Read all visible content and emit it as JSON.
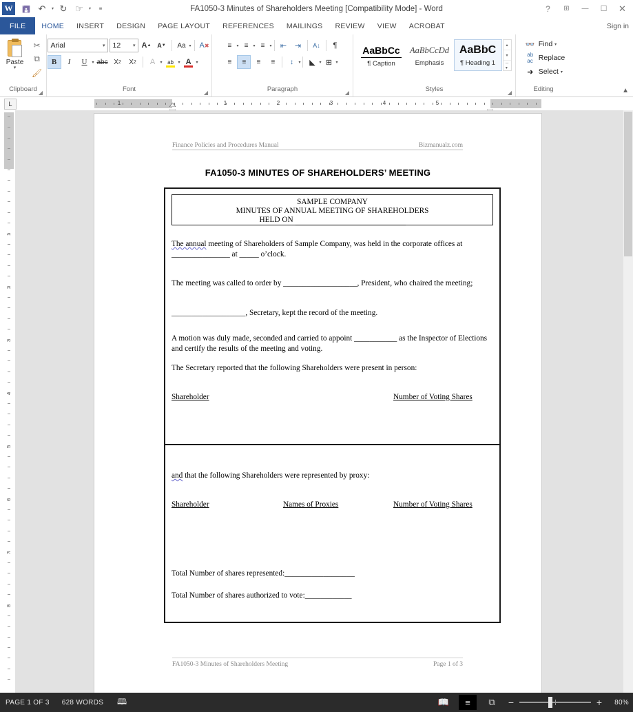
{
  "titlebar": {
    "app_icon": "word-logo-icon",
    "quick_access": [
      {
        "name": "save-button",
        "glyph": "▣"
      },
      {
        "name": "undo-button",
        "glyph": "↶"
      },
      {
        "name": "redo-button",
        "glyph": "↻"
      },
      {
        "name": "touch-mode-button",
        "glyph": "☝"
      },
      {
        "name": "customize-quick-access-button",
        "glyph": "☰"
      }
    ],
    "title": "FA1050-3 Minutes of Shareholders Meeting [Compatibility Mode] - Word",
    "help": "?",
    "ribbon_display_options": "⬆",
    "minimize": "—",
    "restore": "❐",
    "close": "✕"
  },
  "tabs": [
    {
      "label": "FILE",
      "active": false,
      "file": true
    },
    {
      "label": "HOME",
      "active": true
    },
    {
      "label": "INSERT",
      "active": false
    },
    {
      "label": "DESIGN",
      "active": false
    },
    {
      "label": "PAGE LAYOUT",
      "active": false
    },
    {
      "label": "REFERENCES",
      "active": false
    },
    {
      "label": "MAILINGS",
      "active": false
    },
    {
      "label": "REVIEW",
      "active": false
    },
    {
      "label": "VIEW",
      "active": false
    },
    {
      "label": "ACROBAT",
      "active": false
    }
  ],
  "signin": "Sign in",
  "ribbon": {
    "clipboard": {
      "label": "Clipboard",
      "paste": "Paste",
      "paste_arrow": "▾",
      "cut": "✂",
      "copy": "⧉",
      "format_painter": "὘C"
    },
    "font": {
      "label": "Font",
      "font_name": "Arial",
      "font_size": "12",
      "grow_font": "A",
      "shrink_font": "A",
      "change_case": "Aa",
      "clear_formatting": "A",
      "bold": "B",
      "italic": "I",
      "underline": "U",
      "strikethrough": "abc",
      "subscript": "X₂",
      "superscript": "X²",
      "text_effects": "A",
      "highlight": "ab",
      "font_color": "A",
      "dropdown_arrow": "▾"
    },
    "paragraph": {
      "label": "Paragraph",
      "bullets": "≡",
      "numbering": "≡",
      "multilevel": "≡",
      "decrease_indent": "⇤",
      "increase_indent": "⇥",
      "sort": "A↓",
      "show_marks": "¶",
      "align_left": "≡",
      "align_center": "≡",
      "align_right": "≡",
      "justify": "≡",
      "line_spacing": "↕",
      "shading": "△",
      "borders": "⊞"
    },
    "styles": {
      "label": "Styles",
      "items": [
        {
          "preview": "AaBbCc",
          "name": "¶ Caption",
          "selected": false,
          "kind": "caption"
        },
        {
          "preview": "AaBbCcDd",
          "name": "Emphasis",
          "selected": false,
          "kind": "emph"
        },
        {
          "preview": "AaBbC",
          "name": "¶ Heading 1",
          "selected": true,
          "kind": "h1"
        }
      ],
      "scroll_up": "▴",
      "scroll_down": "▾",
      "more": "≡"
    },
    "editing": {
      "label": "Editing",
      "find": "Find",
      "find_arrow": "▾",
      "replace": "Replace",
      "select": "Select",
      "select_arrow": "▾"
    },
    "collapse_ribbon": "⌃"
  },
  "ruler": {
    "tab_selector": "L",
    "h_numbers": [
      "1",
      "1",
      "2",
      "3",
      "4",
      "5"
    ],
    "v_numbers": [
      "1",
      "2",
      "3",
      "4",
      "5",
      "6",
      "7",
      "8"
    ]
  },
  "document": {
    "header_left": "Finance Policies and Procedures Manual",
    "header_right": "Bizmanualz.com",
    "title": "FA1050-3 MINUTES OF SHAREHOLDERS’ MEETING",
    "title_box": {
      "line1": "SAMPLE COMPANY",
      "line2": "MINUTES OF ANNUAL MEETING OF SHAREHOLDERS",
      "line3_label": "HELD ON",
      "line3_blank": "_______________________________"
    },
    "paragraphs": [
      {
        "id": "p-annual-meeting",
        "text_pre": "The annual",
        "text": " meeting of Shareholders of Sample Company, was held in the corporate offices at _______________ at _____ o’clock."
      },
      {
        "id": "p-called-to-order",
        "text": "The meeting was called to order by ___________________, President, who chaired the meeting;"
      },
      {
        "id": "p-secretary-record",
        "text": "  ___________________, Secretary, kept the record of the meeting."
      },
      {
        "id": "p-inspector",
        "text": "A motion was duly made, seconded and carried to appoint ___________ as the Inspector of Elections and certify the results of the meeting and voting."
      },
      {
        "id": "p-present-in-person",
        "text": "The Secretary reported that the following Shareholders were present in person:"
      },
      {
        "id": "p-proxy-intro-pre",
        "text_pre": "and",
        "text": " that the following Shareholders were represented by proxy:"
      }
    ],
    "table1_headers": [
      "Shareholder ",
      "Number of Voting Shares"
    ],
    "table2_headers": [
      "Shareholder ",
      "Names of Proxies",
      "Number of Voting Shares"
    ],
    "totals": [
      "Total Number of shares represented:__________________",
      "Total Number of shares authorized to vote:____________"
    ],
    "footer_left": "FA1050-3 Minutes of Shareholders Meeting",
    "footer_right": "Page 1 of 3"
  },
  "status": {
    "page": "PAGE 1 OF 3",
    "words": "628 WORDS",
    "proofing_icon": "ὖB",
    "views": [
      {
        "name": "read-mode-view-button",
        "glyph": "Ὅ6",
        "active": false
      },
      {
        "name": "print-layout-view-button",
        "glyph": "☰",
        "active": true
      },
      {
        "name": "web-layout-view-button",
        "glyph": "⧉",
        "active": false
      }
    ],
    "zoom_out": "−",
    "zoom_in": "+",
    "zoom_value": "80%"
  }
}
